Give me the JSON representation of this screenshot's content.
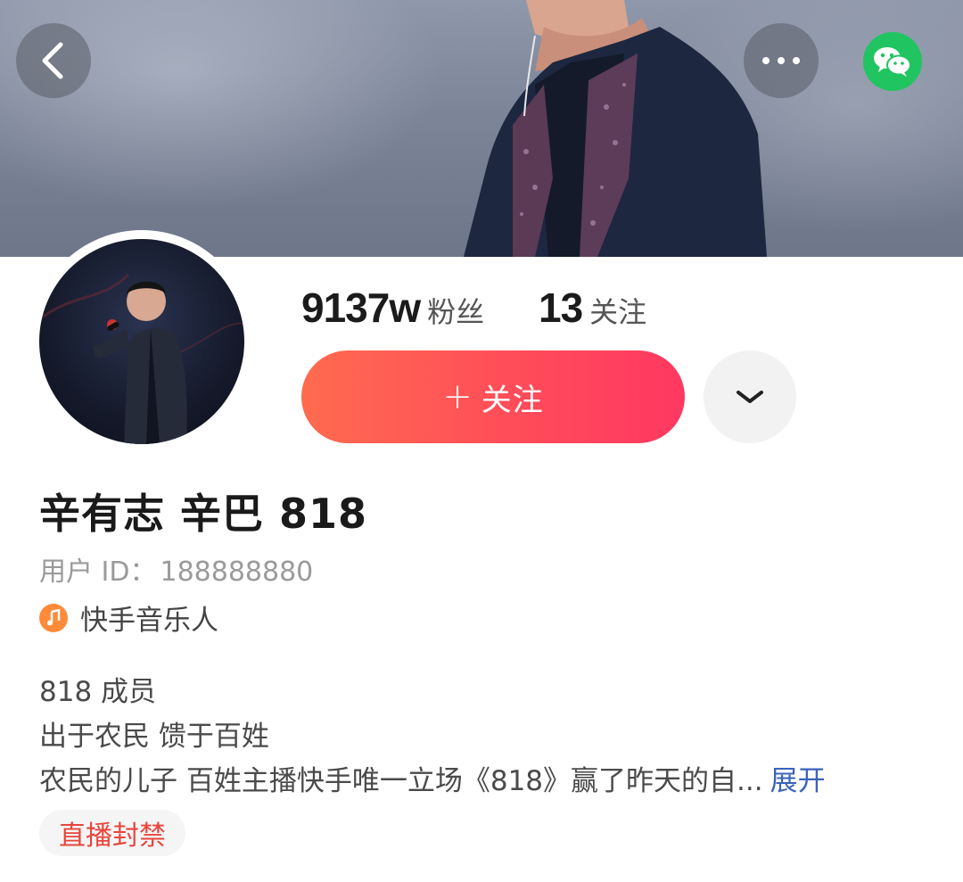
{
  "header": {
    "back_icon": "chevron-left-icon",
    "more_icon": "more-horizontal-icon",
    "share_icon": "wechat-icon",
    "share_color": "#20c460"
  },
  "profile": {
    "fans_count": "9137w",
    "fans_label": "粉丝",
    "following_count": "13",
    "following_label": "关注",
    "follow_button_plus": "+",
    "follow_button_label": "关注",
    "follow_button_color": "#ff4a5a",
    "expand_icon": "chevron-down-icon",
    "name": "辛有志 辛巴 818",
    "uid_label": "用户 ID：",
    "uid_value": "188888880",
    "badge_icon": "music-note-icon",
    "badge_label": "快手音乐人",
    "bio_line1": "818 成员",
    "bio_line2": "出于农民 馈于百姓",
    "bio_line3": "农民的儿子  百姓主播快手唯一立场《818》赢了昨天的自...",
    "bio_more": "展开",
    "tag_label": "直播封禁",
    "tag_color": "#e8453c"
  }
}
